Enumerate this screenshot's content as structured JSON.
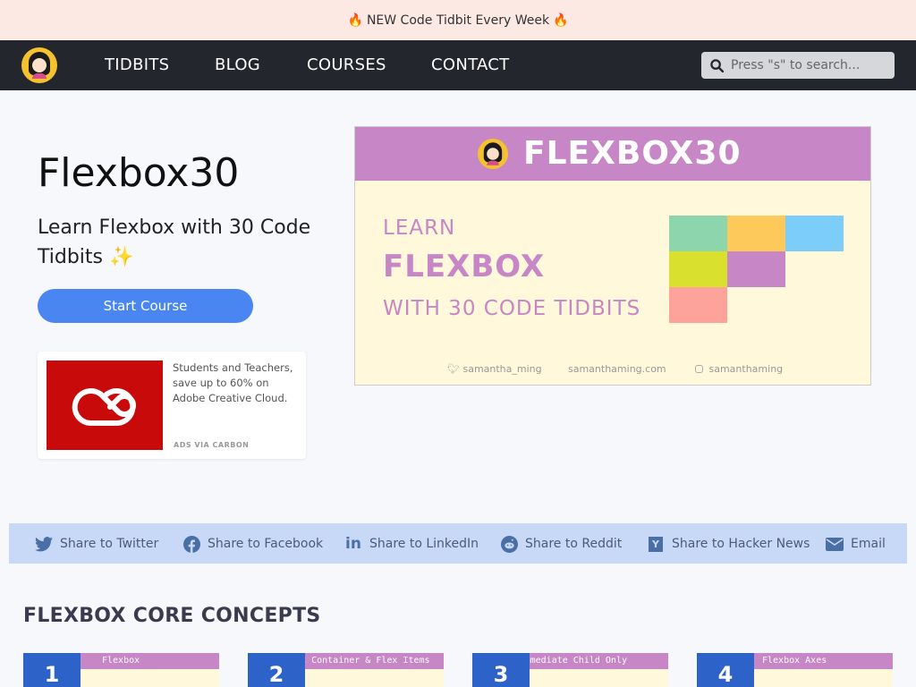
{
  "announcement": {
    "text": "NEW Code Tidbit Every Week",
    "emoji": "🔥"
  },
  "nav": {
    "links": [
      "TIDBITS",
      "BLOG",
      "COURSES",
      "CONTACT"
    ],
    "search_placeholder": "Press \"s\" to search..."
  },
  "hero": {
    "title": "Flexbox30",
    "subtitle": "Learn Flexbox with 30 Code Tidbits ✨",
    "button_label": "Start Course"
  },
  "ad": {
    "text": "Students and Teachers, save up to 60% on Adobe Creative Cloud.",
    "via": "ADS VIA CARBON"
  },
  "banner": {
    "title": "FLEXBOX30",
    "line1": "LEARN",
    "line2": "FLEXBOX",
    "line3": "WITH 30 CODE TIDBITS",
    "twitter": "samantha_ming",
    "site": "samanthaming.com",
    "instagram": "samanthaming",
    "square_colors": [
      "#8dd5ad",
      "#fdc95b",
      "#7dcdfb",
      "#d9e12e",
      "#c786c6",
      "#fda39c"
    ]
  },
  "share": {
    "twitter": "Share to Twitter",
    "facebook": "Share to Facebook",
    "linkedin": "Share to LinkedIn",
    "reddit": "Share to Reddit",
    "hackernews": "Share to Hacker News",
    "email": "Email"
  },
  "section": {
    "title": "FLEXBOX CORE CONCEPTS"
  },
  "cards": [
    {
      "num": "1",
      "label": "Flexbox"
    },
    {
      "num": "2",
      "label": "Flex Container & Flex Items"
    },
    {
      "num": "3",
      "label": "Immediate Child Only"
    },
    {
      "num": "4",
      "label": "Flexbox Axes"
    }
  ],
  "colors": {
    "accent": "#4a86f2",
    "brand_purple": "#c786c6",
    "nav_bg": "#24262d",
    "announce_bg": "#fde9e4",
    "share_bg": "#c8d9f8",
    "card_number_bg": "#2d63c8"
  }
}
